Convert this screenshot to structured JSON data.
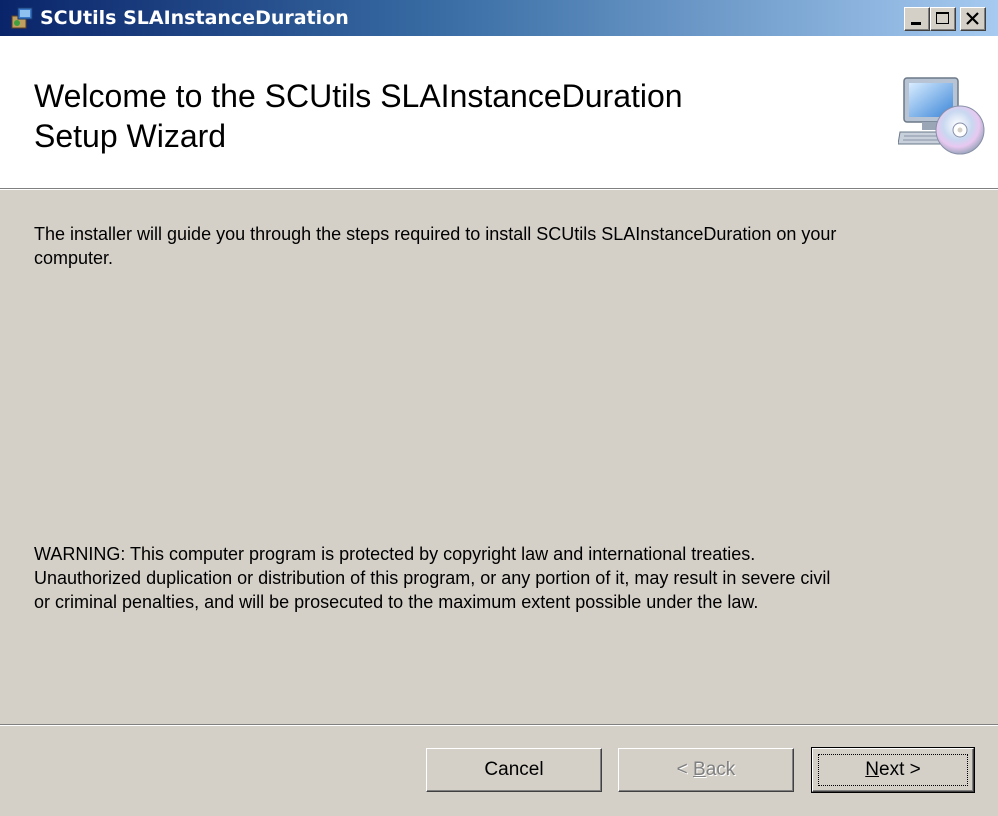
{
  "window": {
    "title": "SCUtils SLAInstanceDuration",
    "controls": {
      "minimize": "minimize",
      "maximize": "maximize",
      "close": "close"
    }
  },
  "banner": {
    "title_line1": "Welcome to the SCUtils SLAInstanceDuration",
    "title_line2": "Setup Wizard",
    "icon": "computer-with-cd-icon"
  },
  "content": {
    "intro_line1": "The installer will guide you through the steps required to install SCUtils SLAInstanceDuration on your",
    "intro_line2": "computer.",
    "warning_line1": "WARNING: This computer program is protected by copyright law and international treaties.",
    "warning_line2": "Unauthorized duplication or distribution of this program, or any portion of it, may result in severe civil",
    "warning_line3": "or criminal penalties, and will be prosecuted to the maximum extent possible under the law."
  },
  "buttons": {
    "cancel": "Cancel",
    "back_prefix": "< ",
    "back_access": "B",
    "back_rest": "ack",
    "next_access": "N",
    "next_rest": "ext >"
  }
}
